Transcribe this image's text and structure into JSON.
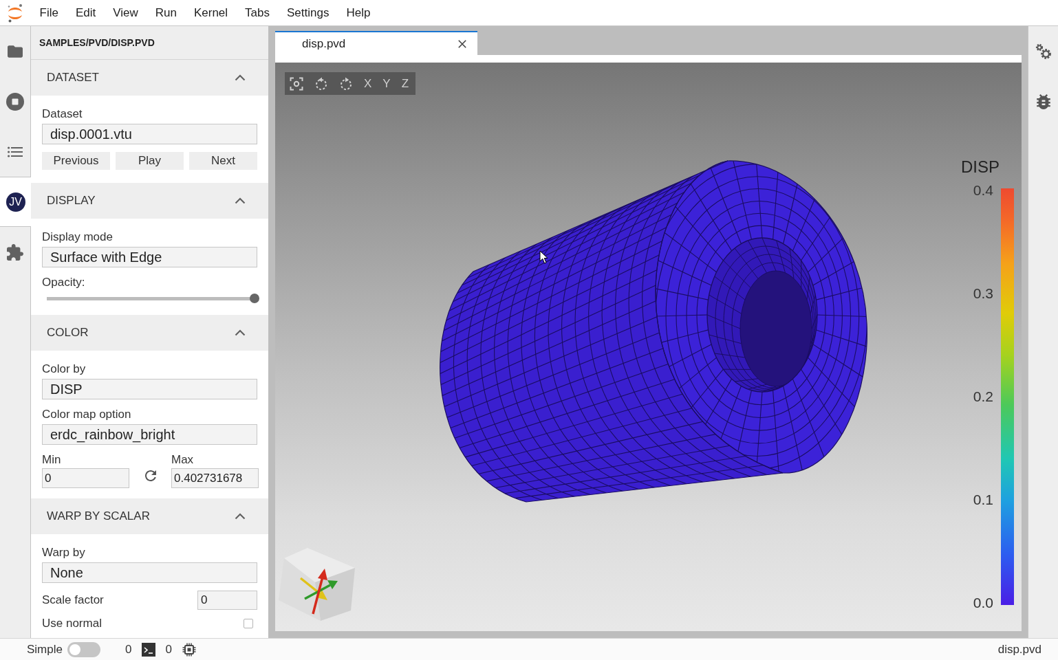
{
  "menu_bar": {
    "items": [
      "File",
      "Edit",
      "View",
      "Run",
      "Kernel",
      "Tabs",
      "Settings",
      "Help"
    ]
  },
  "activity_bar": {
    "items": [
      {
        "selected": false
      },
      {
        "selected": false
      },
      {
        "selected": false
      },
      {
        "avatar": "JV",
        "selected": true
      },
      {
        "selected": false
      }
    ]
  },
  "panel": {
    "path": "SAMPLES/PVD/DISP.PVD",
    "sections": [
      {
        "title": "DATASET",
        "expanded": true,
        "fields": [
          {
            "kind": "select",
            "label": "Dataset",
            "value": "disp.0001.vtu"
          },
          {
            "kind": "buttons",
            "buttons": [
              "Previous",
              "Play",
              "Next"
            ]
          }
        ]
      },
      {
        "title": "DISPLAY",
        "expanded": true,
        "fields": [
          {
            "kind": "select",
            "label": "Display mode",
            "value": "Surface with Edge"
          },
          {
            "kind": "slider",
            "label": "Opacity:",
            "level": 1.0
          }
        ]
      },
      {
        "title": "COLOR",
        "expanded": true,
        "fields": [
          {
            "kind": "select",
            "label": "Color by",
            "value": "DISP"
          },
          {
            "kind": "select",
            "label": "Color map option",
            "value": "erdc_rainbow_bright"
          },
          {
            "kind": "range",
            "min": {
              "label": "Min",
              "value": "0"
            },
            "max": {
              "label": "Max",
              "value": "0.402731678"
            }
          }
        ]
      },
      {
        "title": "WARP BY SCALAR",
        "expanded": true,
        "fields": [
          {
            "kind": "select",
            "label": "Warp by",
            "value": "None"
          },
          {
            "kind": "number",
            "label": "Scale factor",
            "value": "0"
          },
          {
            "kind": "checkbox",
            "label": "Use normal",
            "checked": false
          }
        ]
      }
    ]
  },
  "dock": {
    "tabs": [
      {
        "label": "disp.pvd",
        "selected": true
      }
    ]
  },
  "viewer": {
    "axis_buttons": [
      "X",
      "Y",
      "Z"
    ],
    "legend": {
      "title": "DISP",
      "ticks": [
        "0.4",
        "0.3",
        "0.2",
        "0.1",
        "0.0"
      ]
    }
  },
  "status_bar": {
    "mode": {
      "label": "Simple",
      "on": false
    },
    "counters": [
      "0",
      "0"
    ],
    "file": "disp.pvd"
  }
}
